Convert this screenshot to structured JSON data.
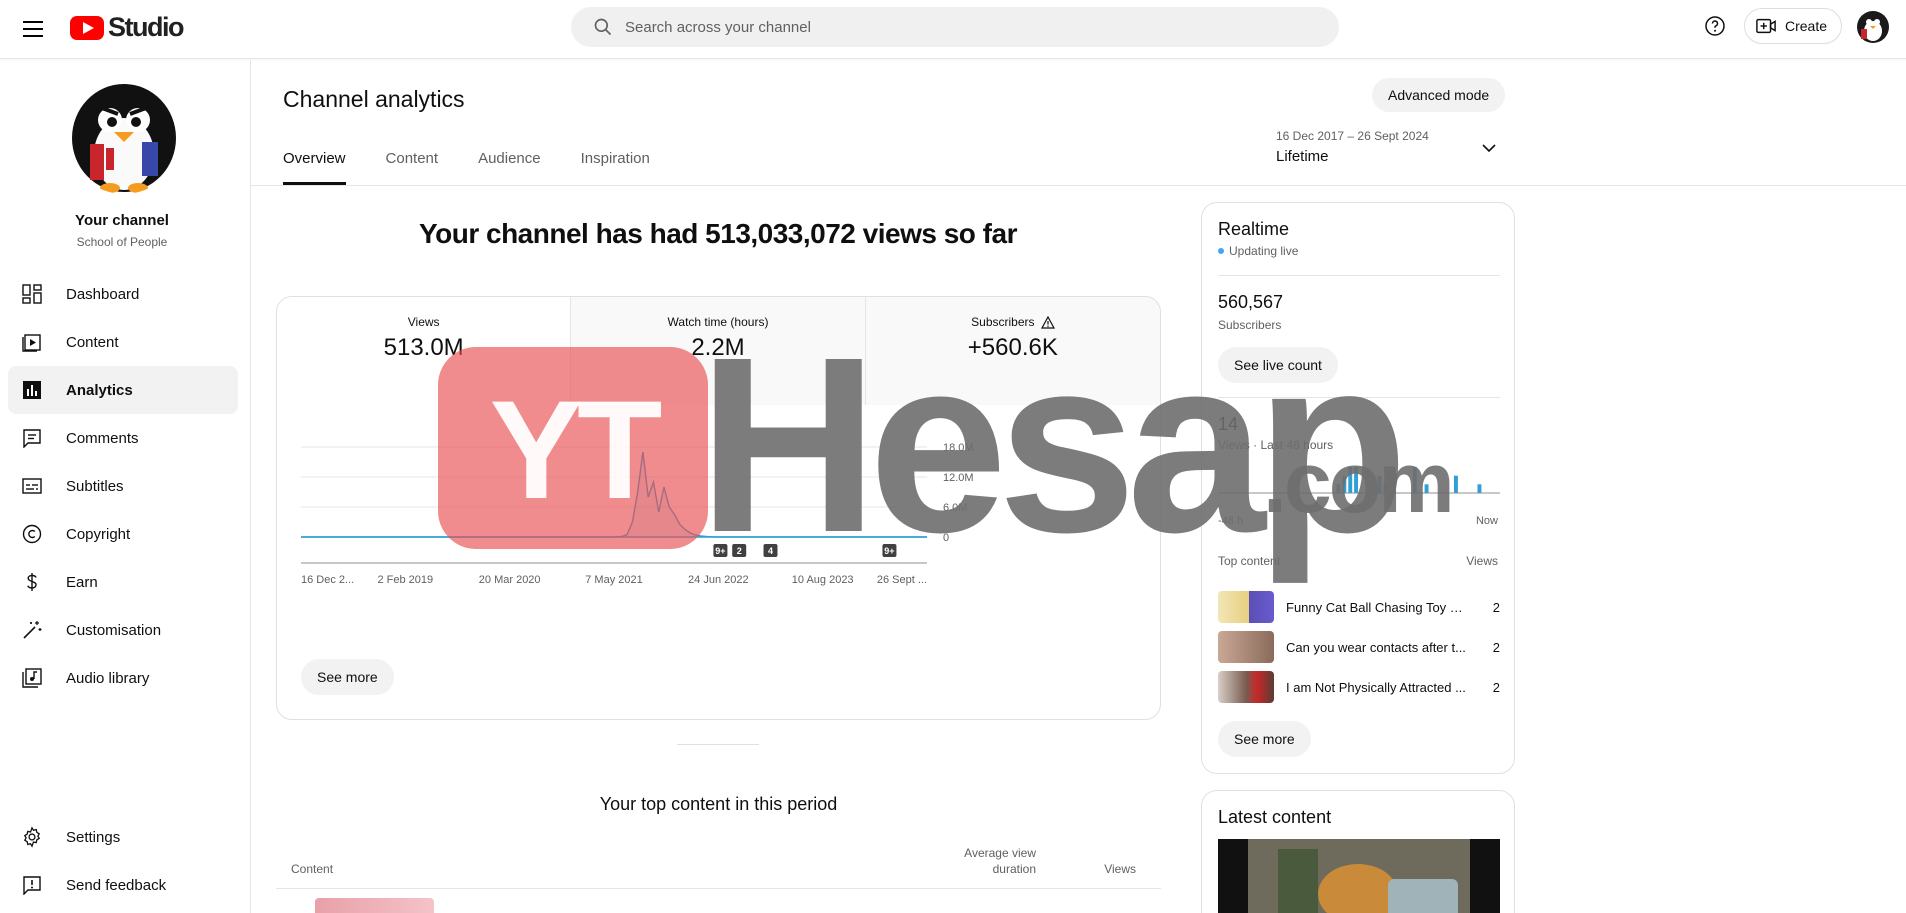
{
  "header": {
    "logo_text": "Studio",
    "search_placeholder": "Search across your channel",
    "create_label": "Create"
  },
  "sidebar": {
    "channel_title": "Your channel",
    "channel_name": "School of People",
    "items": [
      {
        "label": "Dashboard",
        "icon": "dashboard-icon"
      },
      {
        "label": "Content",
        "icon": "content-icon"
      },
      {
        "label": "Analytics",
        "icon": "analytics-icon",
        "active": true
      },
      {
        "label": "Comments",
        "icon": "comments-icon"
      },
      {
        "label": "Subtitles",
        "icon": "subtitles-icon"
      },
      {
        "label": "Copyright",
        "icon": "copyright-icon"
      },
      {
        "label": "Earn",
        "icon": "earn-icon"
      },
      {
        "label": "Customisation",
        "icon": "customisation-icon"
      },
      {
        "label": "Audio library",
        "icon": "audio-library-icon"
      }
    ],
    "bottom_items": [
      {
        "label": "Settings",
        "icon": "settings-icon"
      },
      {
        "label": "Send feedback",
        "icon": "feedback-icon"
      }
    ]
  },
  "main": {
    "title": "Channel analytics",
    "advanced_mode_label": "Advanced mode",
    "tabs": [
      "Overview",
      "Content",
      "Audience",
      "Inspiration"
    ],
    "date_range": "16 Dec 2017 – 26 Sept 2024",
    "date_label": "Lifetime",
    "headline": "Your channel has had 513,033,072 views so far",
    "metrics": [
      {
        "label": "Views",
        "value": "513.0M"
      },
      {
        "label": "Watch time (hours)",
        "value": "2.2M"
      },
      {
        "label": "Subscribers",
        "value": "+560.6K"
      }
    ],
    "see_more_label": "See more",
    "top_content_title": "Your top content in this period",
    "table_headers": {
      "content": "Content",
      "avd_line1": "Average view",
      "avd_line2": "duration",
      "views": "Views"
    }
  },
  "chart_data": {
    "type": "line",
    "x_tick_labels": [
      "16 Dec 2...",
      "2 Feb 2019",
      "20 Mar 2020",
      "7 May 2021",
      "24 Jun 2022",
      "10 Aug 2023",
      "26 Sept ..."
    ],
    "y_tick_labels": [
      "0",
      "6.0M",
      "12.0M",
      "18.0M"
    ],
    "ylim": [
      0,
      18000000
    ],
    "series": [
      {
        "values": [
          0,
          0,
          0,
          0,
          0,
          0,
          0,
          0,
          0,
          0,
          0,
          0,
          0,
          0,
          0,
          0,
          0,
          0,
          0,
          0,
          0,
          0,
          0,
          0,
          0,
          0,
          0,
          0,
          0,
          0,
          0,
          0,
          0,
          0,
          0,
          0,
          0,
          0,
          0,
          0,
          0,
          0,
          0,
          0,
          0,
          0,
          0,
          0,
          0,
          0,
          0,
          0,
          0,
          0,
          0,
          0,
          0,
          0,
          0,
          0,
          50000,
          100000,
          500000,
          3000000,
          9000000,
          17000000,
          8000000,
          11000000,
          5000000,
          10000000,
          6000000,
          4500000,
          2500000,
          1500000,
          800000,
          400000,
          200000,
          100000,
          50000,
          0,
          0,
          0,
          0,
          0,
          0,
          0,
          0,
          0,
          0,
          0,
          0,
          0,
          0,
          0,
          0,
          0,
          0,
          0,
          0,
          0,
          0,
          0,
          0,
          0,
          0,
          0,
          0,
          0,
          0,
          0,
          0,
          0,
          0,
          0,
          0,
          0,
          0,
          0,
          0,
          0
        ]
      }
    ],
    "markers": [
      {
        "label": "9+",
        "position": 0.67
      },
      {
        "label": "2",
        "position": 0.7
      },
      {
        "label": "4",
        "position": 0.75
      },
      {
        "label": "9+",
        "position": 0.94
      }
    ],
    "grid": true
  },
  "realtime": {
    "title": "Realtime",
    "status": "Updating live",
    "subscribers": "560,567",
    "subscribers_label": "Subscribers",
    "live_count_label": "See live count",
    "views": "14",
    "views_label": "Views · Last 48 hours",
    "axis_left": "-48 h",
    "axis_right": "Now",
    "top_content_label": "Top content",
    "views_col_label": "Views",
    "bars": [
      0,
      0,
      0,
      0,
      0,
      0,
      0,
      0,
      0,
      0,
      0,
      0,
      0,
      0,
      0,
      0,
      0,
      0,
      0,
      0,
      1,
      2,
      3,
      3,
      0,
      0,
      0,
      2,
      1,
      0,
      0,
      0,
      0,
      3,
      0,
      1,
      0,
      0,
      0,
      0,
      2,
      0,
      0,
      0,
      1,
      0,
      0,
      0
    ],
    "items": [
      {
        "title": "Funny Cat Ball Chasing Toy - ...",
        "views": "2"
      },
      {
        "title": "Can you wear contacts after t...",
        "views": "2"
      },
      {
        "title": "I am Not Physically Attracted ...",
        "views": "2"
      }
    ],
    "see_more_label": "See more"
  },
  "latest": {
    "title": "Latest content"
  },
  "watermark": {
    "badge": "YT",
    "word": "Hesap",
    "suffix": ".com"
  },
  "colors": {
    "accent": "#3ea6ff",
    "chart_line": "#2f9fd6",
    "brand_red": "#ff0000"
  }
}
